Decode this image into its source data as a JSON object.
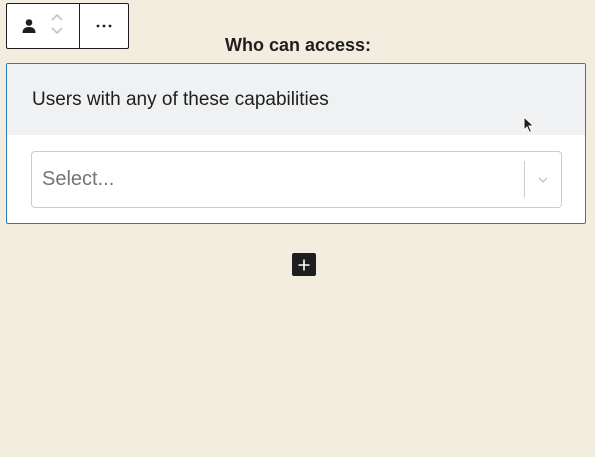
{
  "toolbar": {
    "block_type_icon": "user-icon",
    "move_up_icon": "chevron-up-icon",
    "move_down_icon": "chevron-down-icon",
    "more_options_label": "⋯"
  },
  "heading": "Who can access:",
  "panel": {
    "title": "Users with any of these capabilities",
    "select": {
      "placeholder": "Select...",
      "indicator_icon": "chevron-down-icon"
    }
  },
  "inserter": {
    "icon": "plus-icon"
  },
  "colors": {
    "background": "#f3ede0",
    "accent_border": "#2d7bb6",
    "panel_header": "#f0f1f2",
    "dark": "#1e1e1e",
    "placeholder": "#757575"
  }
}
